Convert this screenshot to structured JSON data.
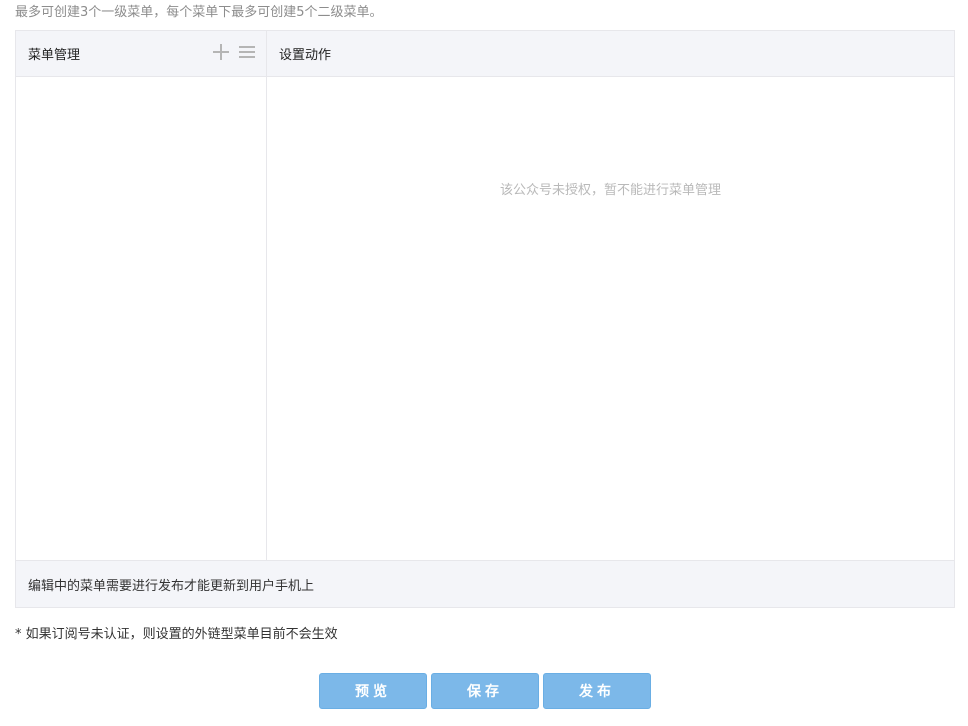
{
  "hint": "最多可创建3个一级菜单，每个菜单下最多可创建5个二级菜单。",
  "menu_panel": {
    "title": "菜单管理",
    "add_icon": "plus-icon",
    "sort_icon": "list-icon"
  },
  "action_panel": {
    "title": "设置动作",
    "empty_message": "该公众号未授权，暂不能进行菜单管理"
  },
  "footer": "编辑中的菜单需要进行发布才能更新到用户手机上",
  "note": "* 如果订阅号未认证，则设置的外链型菜单目前不会生效",
  "buttons": {
    "preview": "预览",
    "save": "保存",
    "publish": "发布"
  },
  "colors": {
    "button_bg": "#7cb8e9",
    "header_bg": "#f4f5f9",
    "border": "#e7e7eb"
  }
}
